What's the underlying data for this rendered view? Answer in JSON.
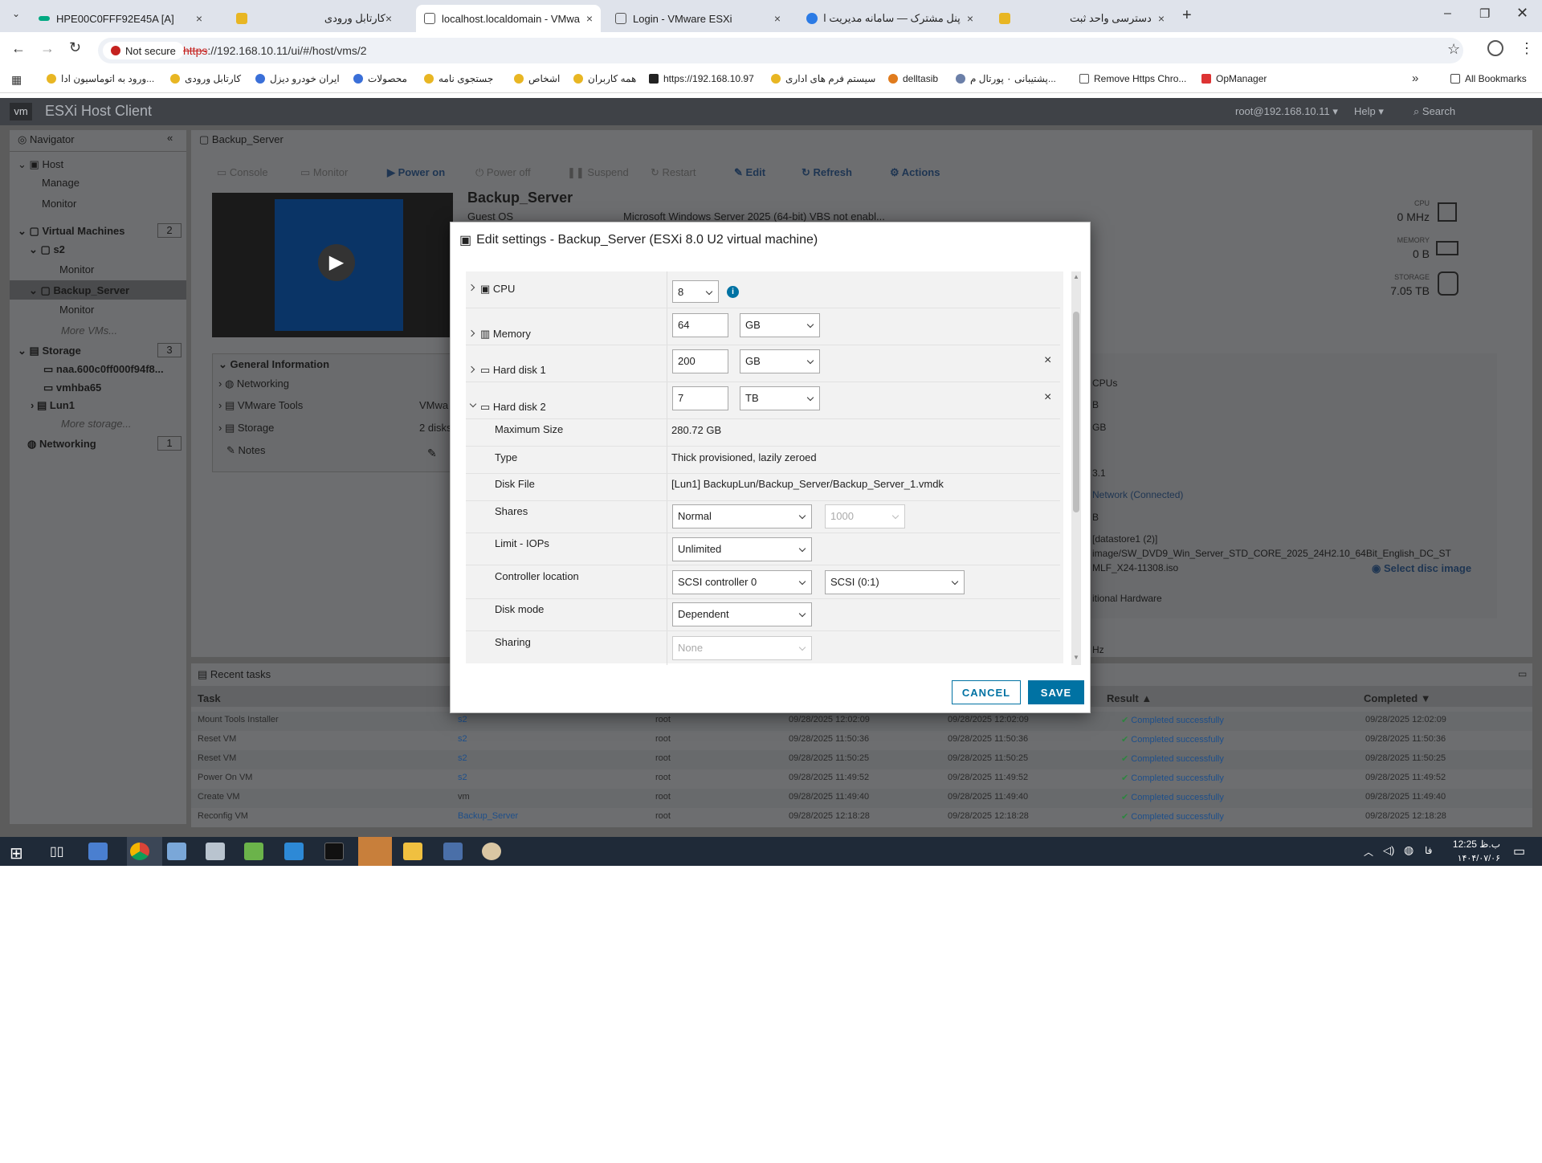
{
  "browser": {
    "tabs": [
      {
        "title": "HPE00C0FFF92E45A [A]",
        "close": "×"
      },
      {
        "title": "کارتابل ورودی",
        "close": "×"
      },
      {
        "title": "localhost.localdomain - VMware",
        "close": "×"
      },
      {
        "title": "Login - VMware ESXi",
        "close": "×"
      },
      {
        "title": "پنل مشترک — سامانه مدیریت ای",
        "close": "×"
      },
      {
        "title": "دسترسی واحد ثبت",
        "close": "×"
      }
    ],
    "new_tab": "+",
    "security_label": "Not secure",
    "url_scheme": "https",
    "url_rest": "://192.168.10.11/ui/#/host/vms/2",
    "bookmarks": [
      "ورود به اتوماسیون ادا...",
      "کارتابل ورودی",
      "ایران خودرو دیزل",
      "محصولات",
      "جستجوی نامه",
      "اشخاص",
      "همه کاربران",
      "https://192.168.10.97",
      "سیستم فرم های اداری",
      "delltasib",
      "پشتیبانی ۰ پورتال م...",
      "Remove Https Chro...",
      "OpManager"
    ],
    "bookmarks_more": "»",
    "all_bookmarks": "All Bookmarks"
  },
  "esxi": {
    "brand_prefix": "vm",
    "brand": "ESXi Host Client",
    "user": "root@192.168.10.11",
    "help": "Help",
    "search": "Search",
    "navigator": {
      "title": "Navigator",
      "host": "Host",
      "manage": "Manage",
      "monitor": "Monitor",
      "vms": "Virtual Machines",
      "vms_count": "2",
      "vm1": "s2",
      "vm1_monitor": "Monitor",
      "vm2": "Backup_Server",
      "vm2_monitor": "Monitor",
      "more_vms": "More VMs...",
      "storage": "Storage",
      "storage_count": "3",
      "ds1": "naa.600c0ff000f94f8...",
      "ds2": "vmhba65",
      "ds3": "Lun1",
      "more_storage": "More storage...",
      "networking": "Networking",
      "net_count": "1"
    },
    "vm": {
      "title": "Backup_Server",
      "toolbar": [
        "Console",
        "Monitor",
        "Power on",
        "Power off",
        "Suspend",
        "Restart",
        "Edit",
        "Refresh",
        "Actions"
      ],
      "name": "Backup_Server",
      "guest_os_label": "Guest OS",
      "guest_os_value": "Microsoft Windows Server 2025 (64-bit) VBS not enabl...",
      "cpu_label": "CPU",
      "cpu_value": "0 MHz",
      "memory_label": "MEMORY",
      "memory_value": "0 B",
      "storage_label": "STORAGE",
      "storage_value": "7.05 TB",
      "general_info": "General Information",
      "gi_items": [
        "Networking",
        "VMware Tools",
        "Storage",
        "Notes"
      ],
      "gi_vals": [
        "",
        "VMwa",
        "2 disks",
        ""
      ],
      "right_bits": [
        "CPUs",
        "B",
        "GB",
        "3.1",
        "Network (Connected)",
        "B",
        "[datastore1 (2)]",
        "image/SW_DVD9_Win_Server_STD_CORE_2025_24H2.10_64Bit_English_DC_ST",
        "MLF_X24-11308.iso",
        "Select disc image",
        "itional Hardware",
        "Hz"
      ]
    },
    "tasks": {
      "title": "Recent tasks",
      "columns": [
        "Task",
        "Result",
        "Completed"
      ],
      "rows": [
        [
          "Mount Tools Installer",
          "s2",
          "root",
          "09/28/2025 12:02:09",
          "09/28/2025 12:02:09",
          "Completed successfully",
          "09/28/2025 12:02:09"
        ],
        [
          "Reset VM",
          "s2",
          "root",
          "09/28/2025 11:50:36",
          "09/28/2025 11:50:36",
          "Completed successfully",
          "09/28/2025 11:50:36"
        ],
        [
          "Reset VM",
          "s2",
          "root",
          "09/28/2025 11:50:25",
          "09/28/2025 11:50:25",
          "Completed successfully",
          "09/28/2025 11:50:25"
        ],
        [
          "Power On VM",
          "s2",
          "root",
          "09/28/2025 11:49:52",
          "09/28/2025 11:49:52",
          "Completed successfully",
          "09/28/2025 11:49:52"
        ],
        [
          "Create VM",
          "vm",
          "root",
          "09/28/2025 11:49:40",
          "09/28/2025 11:49:40",
          "Completed successfully",
          "09/28/2025 11:49:40"
        ],
        [
          "Reconfig VM",
          "Backup_Server",
          "root",
          "09/28/2025 12:18:28",
          "09/28/2025 12:18:28",
          "Completed successfully",
          "09/28/2025 12:18:28"
        ]
      ]
    }
  },
  "dialog": {
    "title": "Edit settings - Backup_Server (ESXi 8.0 U2 virtual machine)",
    "cpu_label": "CPU",
    "cpu_value": "8",
    "memory_label": "Memory",
    "memory_value": "64",
    "memory_unit": "GB",
    "hd1_label": "Hard disk 1",
    "hd1_value": "200",
    "hd1_unit": "GB",
    "hd2_label": "Hard disk 2",
    "hd2_value": "7",
    "hd2_unit": "TB",
    "max_size_label": "Maximum Size",
    "max_size_value": "280.72 GB",
    "type_label": "Type",
    "type_value": "Thick provisioned, lazily zeroed",
    "disk_file_label": "Disk File",
    "disk_file_value": "[Lun1] BackupLun/Backup_Server/Backup_Server_1.vmdk",
    "shares_label": "Shares",
    "shares_value": "Normal",
    "shares_num": "1000",
    "limit_label": "Limit - IOPs",
    "limit_value": "Unlimited",
    "controller_label": "Controller location",
    "controller_value": "SCSI controller 0",
    "controller_slot": "SCSI (0:1)",
    "disk_mode_label": "Disk mode",
    "disk_mode_value": "Dependent",
    "sharing_label": "Sharing",
    "sharing_value": "None",
    "cancel": "CANCEL",
    "save": "SAVE",
    "remove": "×"
  },
  "taskbar": {
    "time": "12:25 ب.ظ",
    "date": "۱۴۰۴/۰۷/۰۶",
    "lang": "فا"
  },
  "colors": {
    "accent": "#0072a3",
    "link": "#1e4f8a",
    "success": "#2e8540"
  }
}
